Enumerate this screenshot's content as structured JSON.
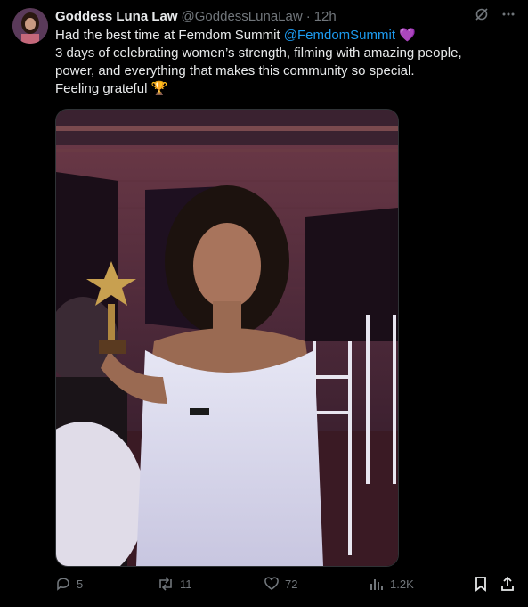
{
  "tweet": {
    "author_name": "Goddess Luna Law",
    "author_handle": "@GoddessLunaLaw",
    "separator": "·",
    "timestamp": "12h",
    "text": {
      "line1_prefix": "Had the best time at Femdom Summit ",
      "mention": "@FemdomSummit",
      "heart_emoji": "💜",
      "line2": "3 days of celebrating women’s strength, filming with amazing people,",
      "line3": "power, and everything that makes this community so special.",
      "line4_text": "Feeling grateful ",
      "trophy_emoji": "🏆"
    },
    "media": {
      "alt": "Woman in a white dress holding a trophy at an event"
    },
    "actions": {
      "replies": "5",
      "reposts": "11",
      "likes": "72",
      "views": "1.2K"
    }
  },
  "colors": {
    "background": "#000000",
    "text_primary": "#e7e9ea",
    "text_secondary": "#71767b",
    "link": "#1d9bf0",
    "border": "#2f3336"
  },
  "icons": {
    "grok": "grok-icon",
    "more": "more-icon",
    "reply": "reply-icon",
    "repost": "repost-icon",
    "like": "like-icon",
    "views": "views-icon",
    "bookmark": "bookmark-icon",
    "share": "share-icon"
  }
}
